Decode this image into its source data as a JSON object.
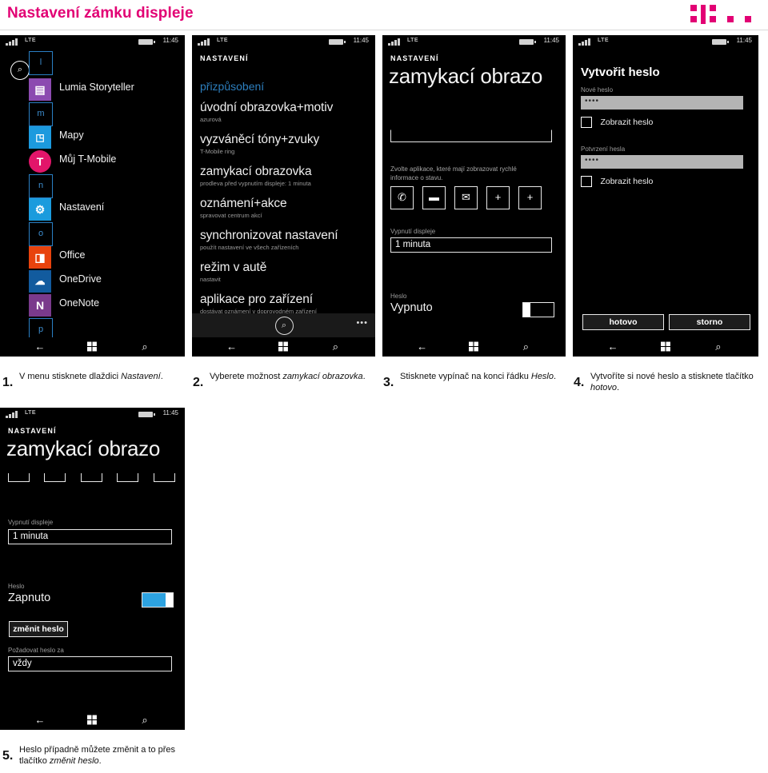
{
  "header": {
    "title": "Nastavení zámku displeje",
    "logo_name": "t-mobile-logo"
  },
  "status_bar": {
    "network": "LTE",
    "time": "11:45"
  },
  "nav_bar": {
    "back": "←",
    "home": "windows-glyph",
    "search": "⌕"
  },
  "phones": [
    {
      "id": "phone-app-list",
      "apps": [
        {
          "label": "",
          "kind": "outline",
          "letter": "l"
        },
        {
          "label": "Lumia Storyteller",
          "kind": "solid",
          "color": "#8c4ab0",
          "glyph": "▤"
        },
        {
          "label": "",
          "kind": "outline",
          "letter": "m"
        },
        {
          "label": "Mapy",
          "kind": "solid",
          "color": "#1c9ade",
          "glyph": "⛁"
        },
        {
          "label": "Můj T-Mobile",
          "kind": "solid",
          "color": "#e2156a",
          "glyph": "T"
        },
        {
          "label": "",
          "kind": "outline",
          "letter": "n"
        },
        {
          "label": "Nastavení",
          "kind": "solid",
          "color": "#1b9bdd",
          "glyph": "⚙"
        },
        {
          "label": "",
          "kind": "outline",
          "letter": "o"
        },
        {
          "label": "Office",
          "kind": "solid",
          "color": "#e8430d",
          "glyph": "◨"
        },
        {
          "label": "OneDrive",
          "kind": "solid",
          "color": "#125b9e",
          "glyph": "☁"
        },
        {
          "label": "OneNote",
          "kind": "solid",
          "color": "#7a3a8c",
          "glyph": "N"
        },
        {
          "label": "",
          "kind": "outline",
          "letter": "p"
        }
      ]
    },
    {
      "id": "phone-settings-list",
      "kicker": "NASTAVENÍ",
      "accent": "přizpůsobení",
      "items": [
        {
          "title": "úvodní obrazovka+motiv",
          "sub": "azurová"
        },
        {
          "title": "vyzváněcí tóny+zvuky",
          "sub": "T-Mobile ring"
        },
        {
          "title": "zamykací obrazovka",
          "sub": "prodleva před vypnutím displeje: 1 minuta"
        },
        {
          "title": "oznámení+akce",
          "sub": "spravovat centrum akcí"
        },
        {
          "title": "synchronizovat nastavení",
          "sub": "použít nastavení ve všech zařízeních"
        },
        {
          "title": "režim v autě",
          "sub": "nastavit"
        },
        {
          "title": "aplikace pro zařízení",
          "sub": "dostávat oznámení v doprovodném zařízení"
        }
      ],
      "appbar": {
        "search_icon": "⌕",
        "more": "•••"
      }
    },
    {
      "id": "phone-lockscreen-off",
      "kicker": "NASTAVENÍ",
      "big_title": "zamykací obrazo",
      "cut_field_value": "",
      "hint": "Zvolte aplikace, které mají zobrazovat rychlé informace o stavu.",
      "quick_icons": [
        "phone-icon",
        "message-icon",
        "mail-icon",
        "plus-icon",
        "plus-icon"
      ],
      "timeout_label": "Vypnutí displeje",
      "timeout_value": "1 minuta",
      "password_label": "Heslo",
      "password_state": "Vypnuto",
      "toggle_on": false
    },
    {
      "id": "phone-create-password",
      "title": "Vytvořit heslo",
      "new_password_label": "Nové heslo",
      "new_password_value": "••••",
      "show_password_1": "Zobrazit heslo",
      "confirm_password_label": "Potvrzení hesla",
      "confirm_password_value": "••••",
      "show_password_2": "Zobrazit heslo",
      "done_button": "hotovo",
      "cancel_button": "storno"
    },
    {
      "id": "phone-lockscreen-on",
      "kicker": "NASTAVENÍ",
      "big_title": "zamykací obrazo",
      "timeout_label": "Vypnutí displeje",
      "timeout_value": "1 minuta",
      "password_label": "Heslo",
      "password_state": "Zapnuto",
      "toggle_on": true,
      "change_password_button": "změnit heslo",
      "require_label": "Požadovat heslo za",
      "require_value": "vždy"
    }
  ],
  "captions": [
    {
      "num": "1.",
      "text_a": "V menu stisknete dlaždici ",
      "em": "Nastavení",
      "text_b": "."
    },
    {
      "num": "2.",
      "text_a": "Vyberete možnost ",
      "em": "zamykací obrazovka",
      "text_b": "."
    },
    {
      "num": "3.",
      "text_a": "Stisknete vypínač na konci řádku ",
      "em": "Heslo",
      "text_b": "."
    },
    {
      "num": "4.",
      "text_a": "Vytvoříte si nové heslo a stisknete tlačítko ",
      "em": "hotovo",
      "text_b": "."
    },
    {
      "num": "5.",
      "text_a": "Heslo případně můžete změnit a to přes tlačítko ",
      "em": "změnit heslo",
      "text_b": "."
    }
  ],
  "colors": {
    "magenta": "#e20074",
    "accent_blue": "#2d7fbe",
    "toggle_on": "#2da2e0"
  }
}
